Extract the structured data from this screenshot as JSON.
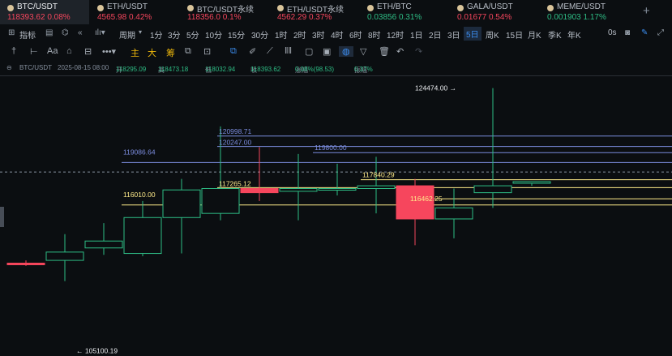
{
  "tabs": [
    {
      "symbol": "BTC/USDT",
      "price": "118393.62",
      "change": "0.08%",
      "dir": "up",
      "active": true
    },
    {
      "symbol": "ETH/USDT",
      "price": "4565.98",
      "change": "0.42%",
      "dir": "dn"
    },
    {
      "symbol": "BTC/USDT永续",
      "price": "118356.0",
      "change": "0.1%",
      "dir": "dn"
    },
    {
      "symbol": "ETH/USDT永续",
      "price": "4562.29",
      "change": "0.37%",
      "dir": "dn"
    },
    {
      "symbol": "ETH/BTC",
      "price": "0.03856",
      "change": "0.31%",
      "dir": "up"
    },
    {
      "symbol": "GALA/USDT",
      "price": "0.01677",
      "change": "0.54%",
      "dir": "dn"
    },
    {
      "symbol": "MEME/USDT",
      "price": "0.001903",
      "change": "1.17%",
      "dir": "up"
    }
  ],
  "add_tab_icon": "plus-icon",
  "toolbar1": {
    "indicator_label": "指标",
    "period_label": "周期",
    "timeframes": [
      "1分",
      "3分",
      "5分",
      "10分",
      "15分",
      "30分",
      "1时",
      "2时",
      "3时",
      "4时",
      "6时",
      "8时",
      "12时",
      "1日",
      "2日",
      "3日",
      "5日",
      "周K",
      "15日",
      "月K",
      "季K",
      "年K"
    ],
    "selected_timeframe": "5日",
    "seconds_label": "0s"
  },
  "toolbar2": {
    "zhu": "主",
    "da": "大",
    "chou": "筹"
  },
  "info": {
    "pair": "BTC/USDT",
    "datetime": "2025-08-15 08:00",
    "open_label": "开",
    "open": "118295.09",
    "high_label": "高",
    "high": "118473.18",
    "low_label": "低",
    "low": "118032.94",
    "close_label": "收",
    "close": "118393.62",
    "change_label": "涨幅",
    "change": "0.08%(98.53)",
    "amp_label": "振幅",
    "amp": "0.37%"
  },
  "chart_data": {
    "type": "candlestick",
    "colors": {
      "up": "#2ebd85",
      "down": "#f6465d",
      "level_blue": "#7b8cde",
      "level_yellow": "#ffeb8a"
    },
    "candles": [
      {
        "o": 111800,
        "c": 111800,
        "h": 112000,
        "l": 111600,
        "dir": "down"
      },
      {
        "o": 112000,
        "c": 112600,
        "h": 113900,
        "l": 110500,
        "dir": "up"
      },
      {
        "o": 112900,
        "c": 113400,
        "h": 114700,
        "l": 112400,
        "dir": "up"
      },
      {
        "o": 112500,
        "c": 115100,
        "h": 116300,
        "l": 112300,
        "dir": "up"
      },
      {
        "o": 115100,
        "c": 117100,
        "h": 117900,
        "l": 112500,
        "dir": "up"
      },
      {
        "o": 115400,
        "c": 117200,
        "h": 121700,
        "l": 114900,
        "dir": "up"
      },
      {
        "o": 117200,
        "c": 116900,
        "h": 120200,
        "l": 116300,
        "dir": "down"
      },
      {
        "o": 117000,
        "c": 117200,
        "h": 119700,
        "l": 114900,
        "dir": "up"
      },
      {
        "o": 117200,
        "c": 117100,
        "h": 119000,
        "l": 116700,
        "dir": "up"
      },
      {
        "o": 117200,
        "c": 117400,
        "h": 119500,
        "l": 115400,
        "dir": "up"
      },
      {
        "o": 117400,
        "c": 115000,
        "h": 117900,
        "l": 113100,
        "dir": "down"
      },
      {
        "o": 115000,
        "c": 115800,
        "h": 117200,
        "l": 113600,
        "dir": "up"
      },
      {
        "o": 116900,
        "c": 117400,
        "h": 124474,
        "l": 115800,
        "dir": "up"
      },
      {
        "o": 117600,
        "c": 117700,
        "h": 117700,
        "l": 117400,
        "dir": "up"
      }
    ],
    "price_labels": [
      {
        "text": "124474.00",
        "kind": "high-marker"
      },
      {
        "text": "120998.71",
        "kind": "blue"
      },
      {
        "text": "120247.00",
        "kind": "blue"
      },
      {
        "text": "119800.00",
        "kind": "blue"
      },
      {
        "text": "119086.64",
        "kind": "blue"
      },
      {
        "text": "117840.29",
        "kind": "yellow"
      },
      {
        "text": "117265.12",
        "kind": "yellow"
      },
      {
        "text": "116462.25",
        "kind": "yellow"
      },
      {
        "text": "116010.00",
        "kind": "yellow"
      },
      {
        "text": "105100.19",
        "kind": "low-marker"
      }
    ]
  }
}
